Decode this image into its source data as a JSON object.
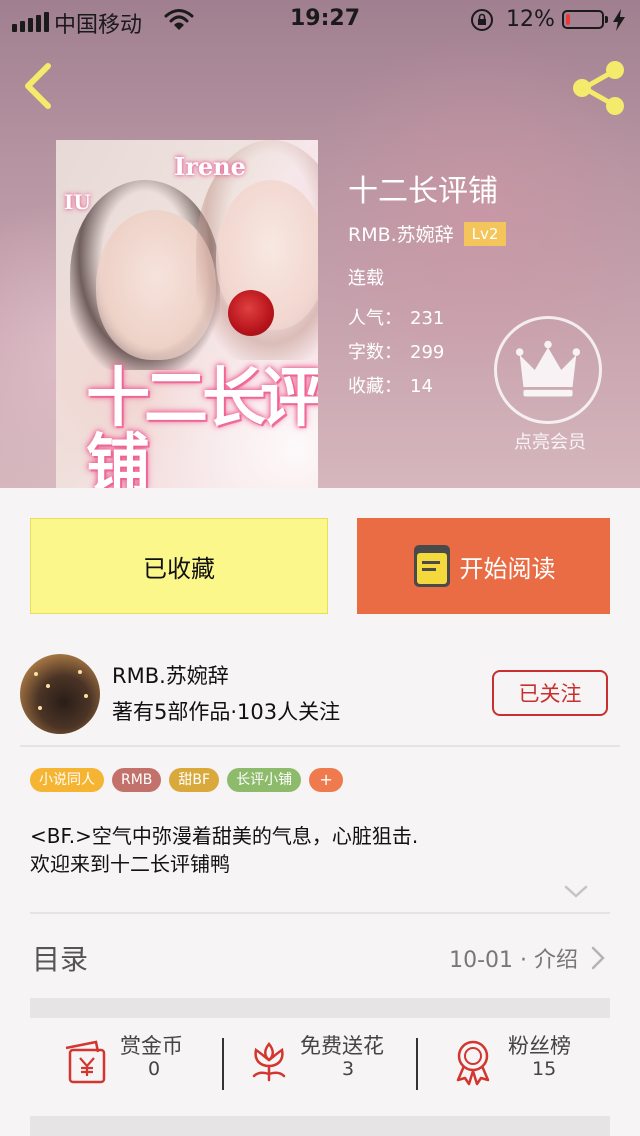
{
  "status_bar": {
    "carrier": "中国移动",
    "time": "19:27",
    "battery_percent": "12%",
    "battery_level": 0.12
  },
  "nav": {
    "back_icon": "chevron-left-icon",
    "share_icon": "share-icon"
  },
  "book": {
    "title": "十二长评铺",
    "author": "RMB.苏婉辞",
    "level": "Lv2",
    "status": "连载",
    "cover_names": [
      "Irene",
      "IU"
    ],
    "cover_title": "十二长评铺",
    "stats": [
      {
        "label": "人气：",
        "value": "231"
      },
      {
        "label": "字数：",
        "value": "299"
      },
      {
        "label": "收藏：",
        "value": "14"
      }
    ]
  },
  "vip": {
    "label": "点亮会员",
    "icon": "crown-icon"
  },
  "actions": {
    "collected_label": "已收藏",
    "read_label": "开始阅读",
    "read_icon": "book-icon"
  },
  "author_card": {
    "name": "RMB.苏婉辞",
    "meta": "著有5部作品·103人关注",
    "follow_label": "已关注"
  },
  "tags": [
    {
      "label": "小说同人",
      "color": "#f5b533"
    },
    {
      "label": "RMB",
      "color": "#c3726b"
    },
    {
      "label": "甜BF",
      "color": "#d9a93c"
    },
    {
      "label": "长评小铺",
      "color": "#8dbb6b"
    },
    {
      "label": "+",
      "color": "#ef7a4e"
    }
  ],
  "intro": {
    "line1": "<BF.>空气中弥漫着甜美的气息，心脏狙击.",
    "line2": "欢迎来到十二长评铺鸭"
  },
  "toc": {
    "label": "目录",
    "info": "10-01 · 介绍"
  },
  "rewards": [
    {
      "label": "赏金币",
      "value": "0",
      "icon": "red-envelope-icon"
    },
    {
      "label": "免费送花",
      "value": "3",
      "icon": "flower-icon"
    },
    {
      "label": "粉丝榜",
      "value": "15",
      "icon": "medal-icon"
    }
  ],
  "colors": {
    "accent_orange": "#ea6c45",
    "collected_yellow": "#fcf78b",
    "follow_red": "#c8302f",
    "level_badge": "#f4c55a",
    "icon_red": "#d2362e"
  }
}
